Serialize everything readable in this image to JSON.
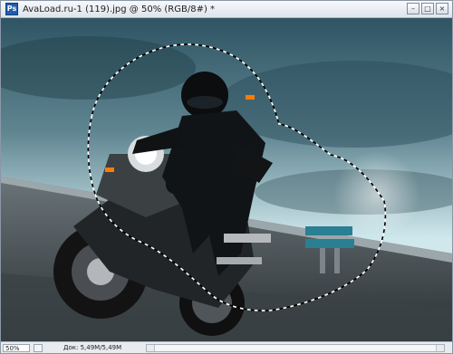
{
  "window": {
    "title": "AvaLoad.ru-1 (119).jpg @ 50% (RGB/8#) *",
    "app_icon_text": "Ps",
    "buttons": {
      "minimize": "–",
      "maximize": "□",
      "close": "×"
    }
  },
  "status": {
    "zoom": "50%",
    "doc_info": "Док: 5,49M/5,49M",
    "arrow": "▶"
  },
  "canvas": {
    "selection": "marching-ants elliptical selection around rider",
    "subject": "motorcycle rider"
  }
}
